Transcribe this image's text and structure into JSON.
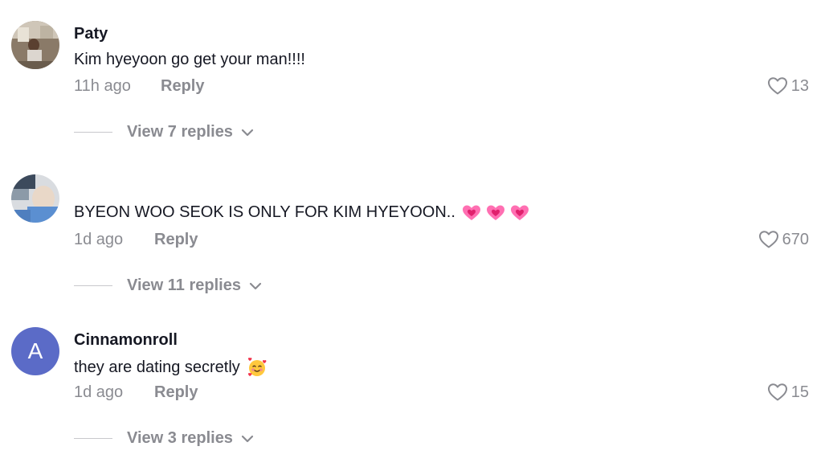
{
  "comments": [
    {
      "username": "Paty",
      "text": "Kim hyeyoon go get your man!!!!",
      "time": "11h ago",
      "reply_label": "Reply",
      "likes": "13",
      "view_replies": "View 7 replies",
      "avatar_type": "photo"
    },
    {
      "username": "",
      "text": "BYEON WOO SEOK IS ONLY FOR KIM HYEYOON..",
      "emojis": [
        "pink-heart-emoji",
        "pink-heart-emoji",
        "pink-heart-emoji"
      ],
      "time": "1d ago",
      "reply_label": "Reply",
      "likes": "670",
      "view_replies": "View 11 replies",
      "avatar_type": "photo"
    },
    {
      "username": "Cinnamonroll",
      "avatar_letter": "A",
      "avatar_color": "#5b6bc7",
      "text": "they are dating secretly",
      "emojis": [
        "smiling-face-with-hearts-emoji"
      ],
      "time": "1d ago",
      "reply_label": "Reply",
      "likes": "15",
      "view_replies": "View 3 replies",
      "avatar_type": "letter"
    }
  ],
  "colors": {
    "primary_text": "#161823",
    "secondary_text": "#8a8b91",
    "avatar_letter_bg": "#5b6bc7"
  },
  "icons": {
    "like": "heart-outline-icon",
    "expand": "chevron-down-icon"
  }
}
